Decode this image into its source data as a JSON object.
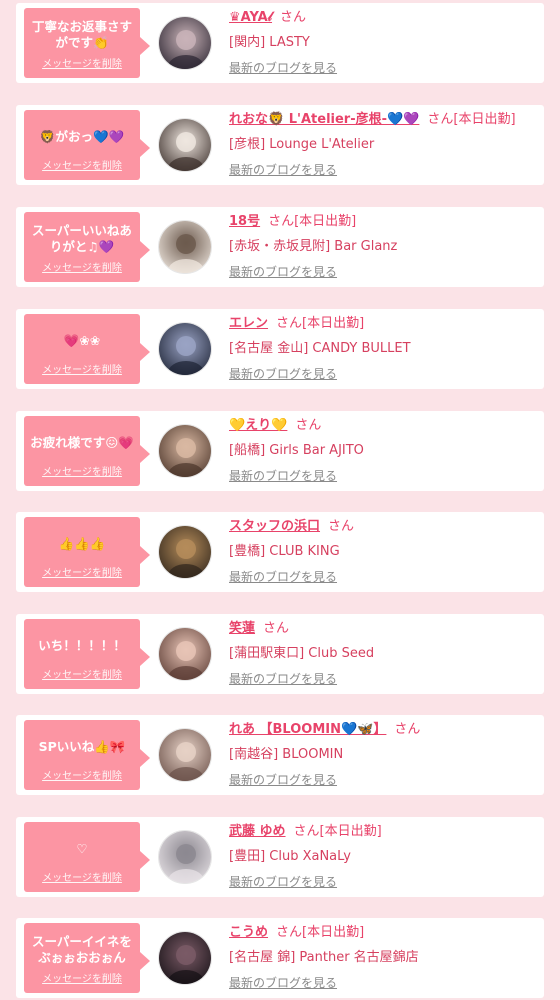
{
  "delete_label": "メッセージを削除",
  "blog_label": "最新のブログを見る",
  "honorific": "さん",
  "colors": {
    "page_bg": "#fbe3e7",
    "bubble": "#fc95a3",
    "accent": "#e8436a",
    "link_gray": "#8a8a8a"
  },
  "messages": [
    {
      "text": "丁寧なお返事さすがです👏",
      "name": "♛AYA𝓁",
      "badge": "",
      "shop": "[関内] LASTY",
      "avatar_colors": [
        "#2a2430",
        "#c9b3b8"
      ]
    },
    {
      "text": "🦁がおっ💙💜",
      "name": "れおな🦁 L'Atelier-彦根-💙💜",
      "badge": "[本日出勤]",
      "shop": "[彦根] Lounge L'Atelier",
      "avatar_colors": [
        "#3a2e2a",
        "#efe6df"
      ]
    },
    {
      "text": "スーパーいいねありがと♫💜",
      "name": "18号",
      "badge": "[本日出勤]",
      "shop": "[赤坂・赤坂見附] Bar Glanz",
      "avatar_colors": [
        "#f3ebe3",
        "#6c5a4e"
      ]
    },
    {
      "text": "💗❀❀",
      "name": "エレン",
      "badge": "[本日出勤]",
      "shop": "[名古屋 金山] CANDY BULLET",
      "avatar_colors": [
        "#1c2233",
        "#9aa3c4"
      ]
    },
    {
      "text": "お疲れ様です😖💗",
      "name": "💛えり💛",
      "badge": "",
      "shop": "[船橋] Girls Bar AJITO",
      "avatar_colors": [
        "#4a3429",
        "#d9b8a2"
      ]
    },
    {
      "text": "👍👍👍",
      "name": "スタッフの浜口",
      "badge": "",
      "shop": "[豊橋] CLUB KING",
      "avatar_colors": [
        "#2e241b",
        "#b58c5a"
      ]
    },
    {
      "text": "いち！！！！！",
      "name": "笑蓮",
      "badge": "",
      "shop": "[蒲田駅東口] Club Seed",
      "avatar_colors": [
        "#5a3b33",
        "#e8c4b6"
      ]
    },
    {
      "text": "SPいいね👍🎀",
      "name": "れあ 【BLOOMIN💙🦋】",
      "badge": "",
      "shop": "[南越谷] BLOOMIN",
      "avatar_colors": [
        "#6a5048",
        "#e6d1c6"
      ]
    },
    {
      "text": "♡",
      "name": "武藤 ゆめ",
      "badge": "[本日出勤]",
      "shop": "[豊田] Club XaNaLy",
      "avatar_colors": [
        "#e9e4e8",
        "#8c8890"
      ]
    },
    {
      "text": "スーパーイイネをぶぉぉおおぉん",
      "name": "こうめ",
      "badge": "[本日出勤]",
      "shop": "[名古屋 錦] Panther 名古屋錦店",
      "avatar_colors": [
        "#141014",
        "#7a5a66"
      ]
    }
  ]
}
